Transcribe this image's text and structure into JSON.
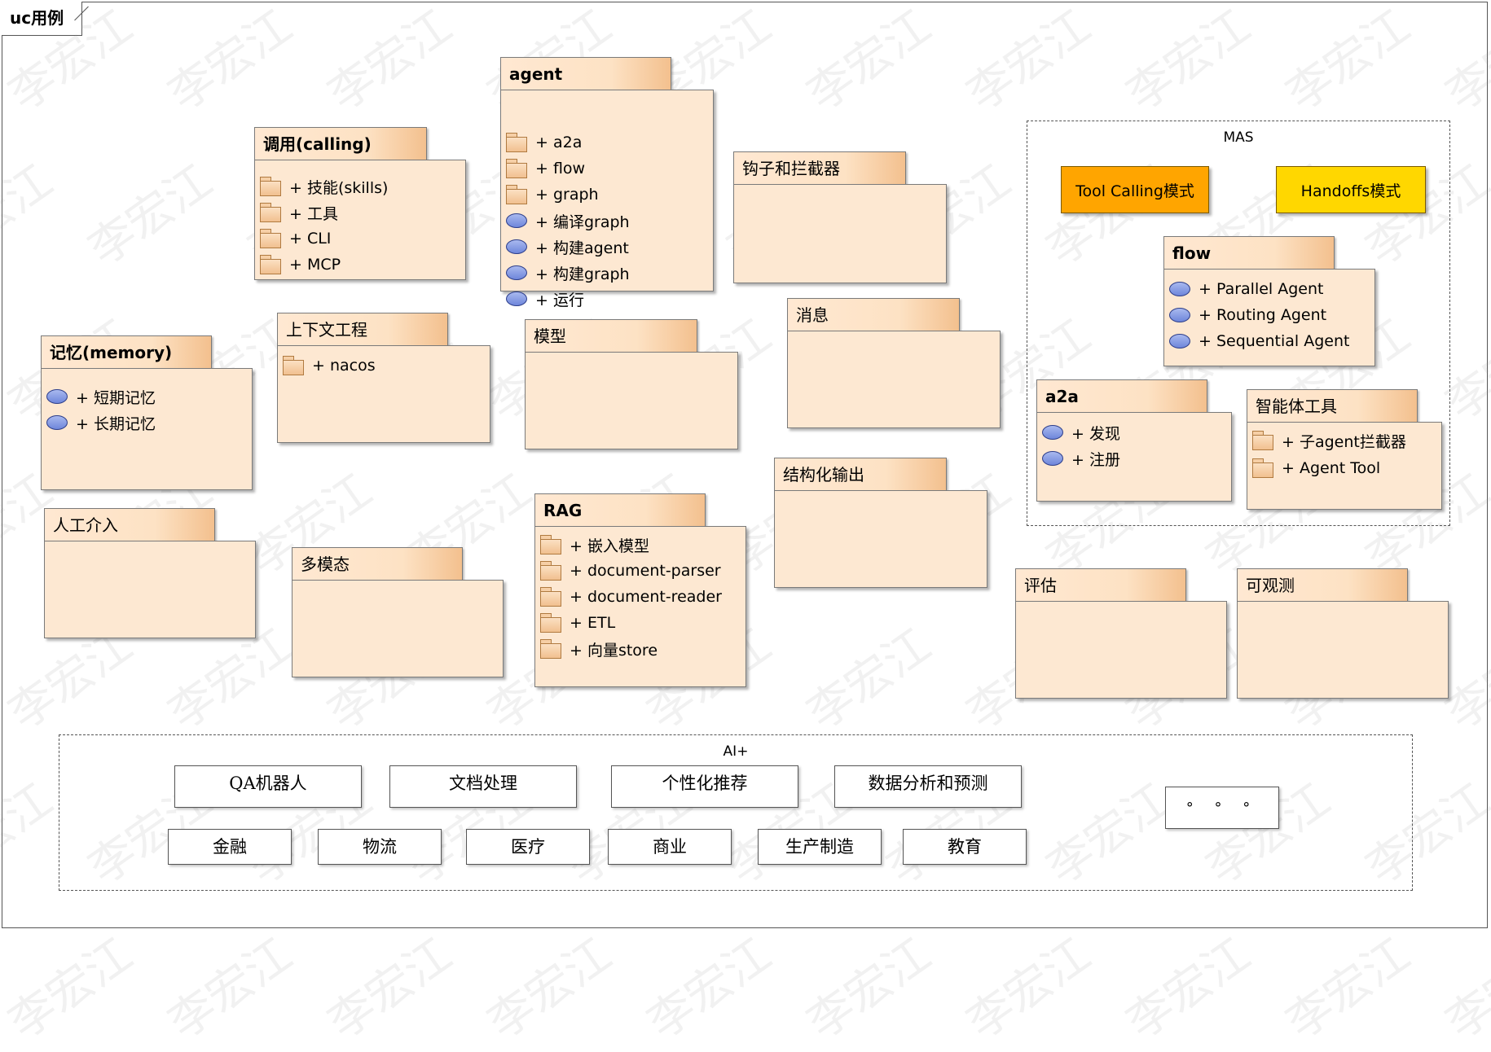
{
  "frame_label": "uc用例",
  "watermark_text": "李宏江",
  "packages": {
    "agent": {
      "title": "agent",
      "items": [
        {
          "icon": "folder",
          "label": "+ a2a"
        },
        {
          "icon": "folder",
          "label": "+ flow"
        },
        {
          "icon": "folder",
          "label": "+ graph"
        },
        {
          "icon": "usecase",
          "label": "+ 编译graph"
        },
        {
          "icon": "usecase",
          "label": "+ 构建agent"
        },
        {
          "icon": "usecase",
          "label": "+ 构建graph"
        },
        {
          "icon": "usecase",
          "label": "+ 运行"
        }
      ]
    },
    "calling": {
      "title": "调用(calling)",
      "items": [
        {
          "icon": "folder",
          "label": "+ 技能(skills)"
        },
        {
          "icon": "folder",
          "label": "+ 工具"
        },
        {
          "icon": "folder",
          "label": "+ CLI"
        },
        {
          "icon": "folder",
          "label": "+ MCP"
        }
      ]
    },
    "hooks": {
      "title": "钩子和拦截器",
      "items": []
    },
    "memory": {
      "title": "记忆(memory)",
      "items": [
        {
          "icon": "usecase",
          "label": "+ 短期记忆"
        },
        {
          "icon": "usecase",
          "label": "+ 长期记忆"
        }
      ]
    },
    "context": {
      "title": "上下文工程",
      "items": [
        {
          "icon": "folder",
          "label": "+ nacos"
        }
      ]
    },
    "model": {
      "title": "模型",
      "items": []
    },
    "message": {
      "title": "消息",
      "items": []
    },
    "human": {
      "title": "人工介入",
      "items": []
    },
    "multimodal": {
      "title": "多模态",
      "items": []
    },
    "rag": {
      "title": "RAG",
      "items": [
        {
          "icon": "folder",
          "label": "+ 嵌入模型"
        },
        {
          "icon": "folder",
          "label": "+ document-parser"
        },
        {
          "icon": "folder",
          "label": "+ document-reader"
        },
        {
          "icon": "folder",
          "label": "+ ETL"
        },
        {
          "icon": "folder",
          "label": "+ 向量store"
        }
      ]
    },
    "structured": {
      "title": "结构化输出",
      "items": []
    },
    "evaluation": {
      "title": "评估",
      "items": []
    },
    "observability": {
      "title": "可观测",
      "items": []
    },
    "flow": {
      "title": "flow",
      "items": [
        {
          "icon": "usecase",
          "label": "+ Parallel Agent"
        },
        {
          "icon": "usecase",
          "label": "+ Routing Agent"
        },
        {
          "icon": "usecase",
          "label": "+ Sequential Agent"
        }
      ]
    },
    "a2a": {
      "title": "a2a",
      "items": [
        {
          "icon": "usecase",
          "label": "+ 发现"
        },
        {
          "icon": "usecase",
          "label": "+ 注册"
        }
      ]
    },
    "agent_tools": {
      "title": "智能体工具",
      "items": [
        {
          "icon": "folder",
          "label": "+ 子agent拦截器"
        },
        {
          "icon": "folder",
          "label": "+ Agent Tool"
        }
      ]
    }
  },
  "mas": {
    "label": "MAS",
    "tool_calling": "Tool Calling模式",
    "handoffs": "Handoffs模式",
    "tool_calling_color": "#ffa500",
    "handoffs_color": "#ffd700"
  },
  "ai_plus": {
    "label": "AI+",
    "row1": [
      "QA机器人",
      "文档处理",
      "个性化推荐",
      "数据分析和预测"
    ],
    "more": "° ° °",
    "row2": [
      "金融",
      "物流",
      "医疗",
      "商业",
      "生产制造",
      "教育"
    ]
  }
}
